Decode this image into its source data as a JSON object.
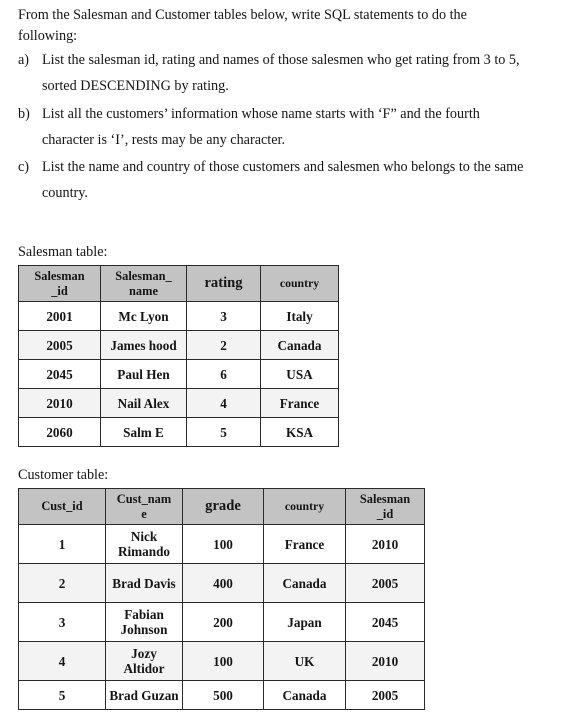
{
  "intro": {
    "line1": "From the Salesman and Customer tables below, write SQL statements to do the",
    "line2": "following:"
  },
  "questions": [
    {
      "marker": "a)",
      "text": "List the salesman id, rating and names of those salesmen who get rating from 3 to 5,",
      "text2": "sorted DESCENDING by rating."
    },
    {
      "marker": "b)",
      "text": "List all the customers’ information whose name starts with ‘F” and the fourth",
      "text2": "character is  ‘I’, rests may be any character."
    },
    {
      "marker": "c)",
      "text": "List the name and country of those customers and salesmen who belongs to the same",
      "text2": "country."
    }
  ],
  "salesman": {
    "caption": "Salesman table:",
    "headers": [
      {
        "line1": "Salesman",
        "line2": "_id"
      },
      {
        "line1": "Salesman_",
        "line2": "name"
      },
      {
        "line1": "rating",
        "line2": ""
      },
      {
        "line1": "country",
        "line2": ""
      }
    ],
    "rows": [
      {
        "id": "2001",
        "name": "Mc Lyon",
        "rating": "3",
        "country": "Italy"
      },
      {
        "id": "2005",
        "name": "James hood",
        "rating": "2",
        "country": "Canada"
      },
      {
        "id": "2045",
        "name": "Paul Hen",
        "rating": "6",
        "country": "USA"
      },
      {
        "id": "2010",
        "name": "Nail Alex",
        "rating": "4",
        "country": "France"
      },
      {
        "id": "2060",
        "name": "Salm E",
        "rating": "5",
        "country": "KSA"
      }
    ]
  },
  "customer": {
    "caption": "Customer table:",
    "headers": [
      {
        "line1": "Cust_id",
        "line2": ""
      },
      {
        "line1": "Cust_nam",
        "line2": "e"
      },
      {
        "line1": "grade",
        "line2": ""
      },
      {
        "line1": "country",
        "line2": ""
      },
      {
        "line1": "Salesman",
        "line2": "_id"
      }
    ],
    "rows": [
      {
        "cust_id": "1",
        "name1": "Nick",
        "name2": "Rimando",
        "grade": "100",
        "country": "France",
        "salesman_id": "2010"
      },
      {
        "cust_id": "2",
        "name1": "Brad Davis",
        "name2": "",
        "grade": "400",
        "country": "Canada",
        "salesman_id": "2005"
      },
      {
        "cust_id": "3",
        "name1": "Fabian",
        "name2": "Johnson",
        "grade": "200",
        "country": "Japan",
        "salesman_id": "2045"
      },
      {
        "cust_id": "4",
        "name1": "Jozy",
        "name2": "Altidor",
        "grade": "100",
        "country": "UK",
        "salesman_id": "2010"
      },
      {
        "cust_id": "5",
        "name1": "Brad Guzan",
        "name2": "",
        "grade": "500",
        "country": "Canada",
        "salesman_id": "2005"
      }
    ]
  },
  "colors": {
    "header_bg": "#c3c3c3",
    "row_alt_bg": "#f3f3f3",
    "border": "#2a2a2a",
    "text": "#151515"
  }
}
